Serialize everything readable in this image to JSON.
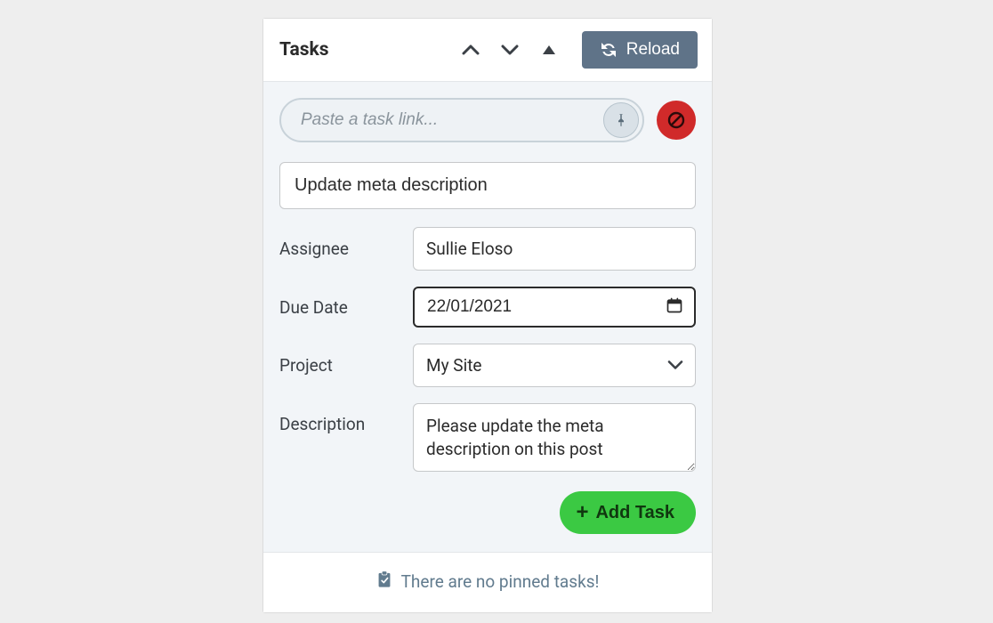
{
  "panel": {
    "title": "Tasks",
    "reload_label": "Reload"
  },
  "link_input": {
    "placeholder": "Paste a task link..."
  },
  "task_form": {
    "title_value": "Update meta description",
    "assignee": {
      "label": "Assignee",
      "value": "Sullie Eloso"
    },
    "due_date": {
      "label": "Due Date",
      "value": "22/01/2021"
    },
    "project": {
      "label": "Project",
      "value": "My Site"
    },
    "description": {
      "label": "Description",
      "value": "Please update the meta description on this post"
    },
    "add_task_label": "Add Task"
  },
  "footer": {
    "empty_message": "There are no pinned tasks!"
  }
}
